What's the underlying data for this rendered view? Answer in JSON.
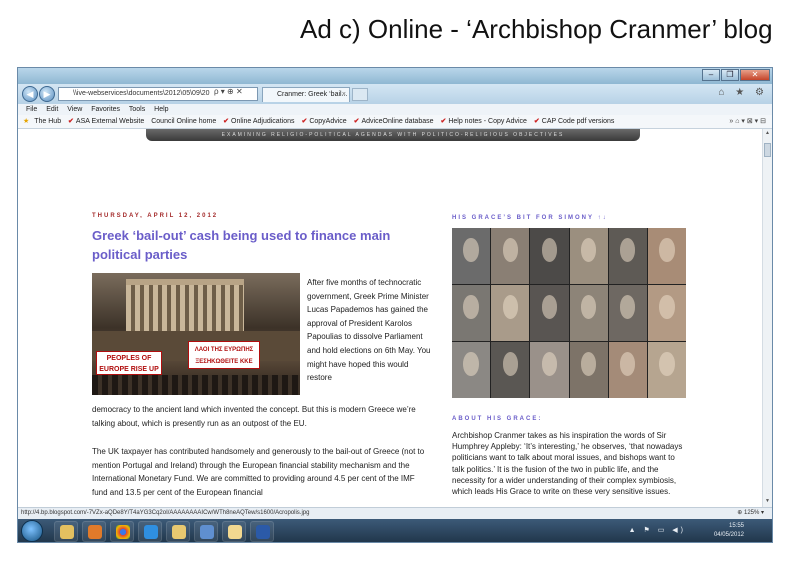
{
  "slide_title": "Ad c) Online - ‘Archbishop Cranmer’ blog",
  "browser": {
    "address": "\\\\ive-webservices\\documents\\2012\\05\\09\\20",
    "address_tools": "ρ ▾ ⊕ ✕",
    "tab_label": "Cranmer: Greek ‘bail...",
    "tab_close": "×",
    "window_controls": {
      "min": "–",
      "max": "❐",
      "close": "✕"
    },
    "right_icons": "⌂ ★ ⚙",
    "menu": [
      "File",
      "Edit",
      "View",
      "Favorites",
      "Tools",
      "Help"
    ],
    "favorites": [
      "The Hub",
      "ASA External Website",
      "Council Online home",
      "Online Adjudications",
      "CopyAdvice",
      "AdviceOnline database",
      "Help notes - Copy Advice",
      "CAP Code pdf versions"
    ],
    "fav_right": "» ⌂ ▾ ⊠ ▾ ⊟"
  },
  "page": {
    "banner": "EXAMINING RELIGIO-POLITICAL AGENDAS WITH POLITICO-RELIGIOUS OBJECTIVES",
    "post": {
      "date": "THURSDAY, APRIL 12, 2012",
      "title": "Greek ‘bail-out’ cash being used to finance main political parties",
      "image_banner_left": "PEOPLES OF EUROPE RISE UP KKE",
      "image_banner_right": "ΛΑΟΙ ΤΗΣ ΕΥΡΩΠΗΣ ΞΕΣΗΚΩΘΕΙΤΕ KKE",
      "para1_side": "After five months of technocratic government, Greek Prime Minister Lucas Papademos has gained the approval of President Karolos Papoulias to dissolve Parliament and hold elections on 6th May. You might have hoped this would restore",
      "para1_cont": "democracy to the ancient land which invented the concept. But this is modern Greece we’re talking about, which is presently run as an outpost of the EU.",
      "para2": "The UK taxpayer has contributed handsomely and generously to the bail-out of Greece (not to mention Portugal and Ireland) through the European financial stability mechanism and the International Monetary Fund. We are committed to providing around 4.5 per cent of the IMF fund and 13.5 per cent of the European financial"
    },
    "sidebar": {
      "heading1": "HIS GRACE’S BIT FOR SIMONY ↑↓",
      "heading2": "ABOUT HIS GRACE:",
      "about": "Archbishop Cranmer takes as his inspiration the words of Sir Humphrey Appleby: ‘It’s interesting,’ he observes, ‘that nowadays politicians want to talk about moral issues, and bishops want to talk politics.’ It is the fusion of the two in public life, and the necessity for a wider understanding of their complex symbiosis, which leads His Grace to write on these very sensitive issues."
    }
  },
  "status": {
    "url": "http://4.bp.blogspot.com/-7VZx-aQDe8Y/T4aYG3Cq2oI/AAAAAAAAICw/WTh8neAQTew/s1600/Acropolis.jpg",
    "zoom": "⊕ 125% ▾"
  },
  "taskbar": {
    "time": "15:55",
    "date": "04/05/2012",
    "tray_icons": "▲ ⚑ ▭ ◀)"
  },
  "colors": {
    "accent_title": "#6a5dc9",
    "date_red": "#a42b2b"
  }
}
